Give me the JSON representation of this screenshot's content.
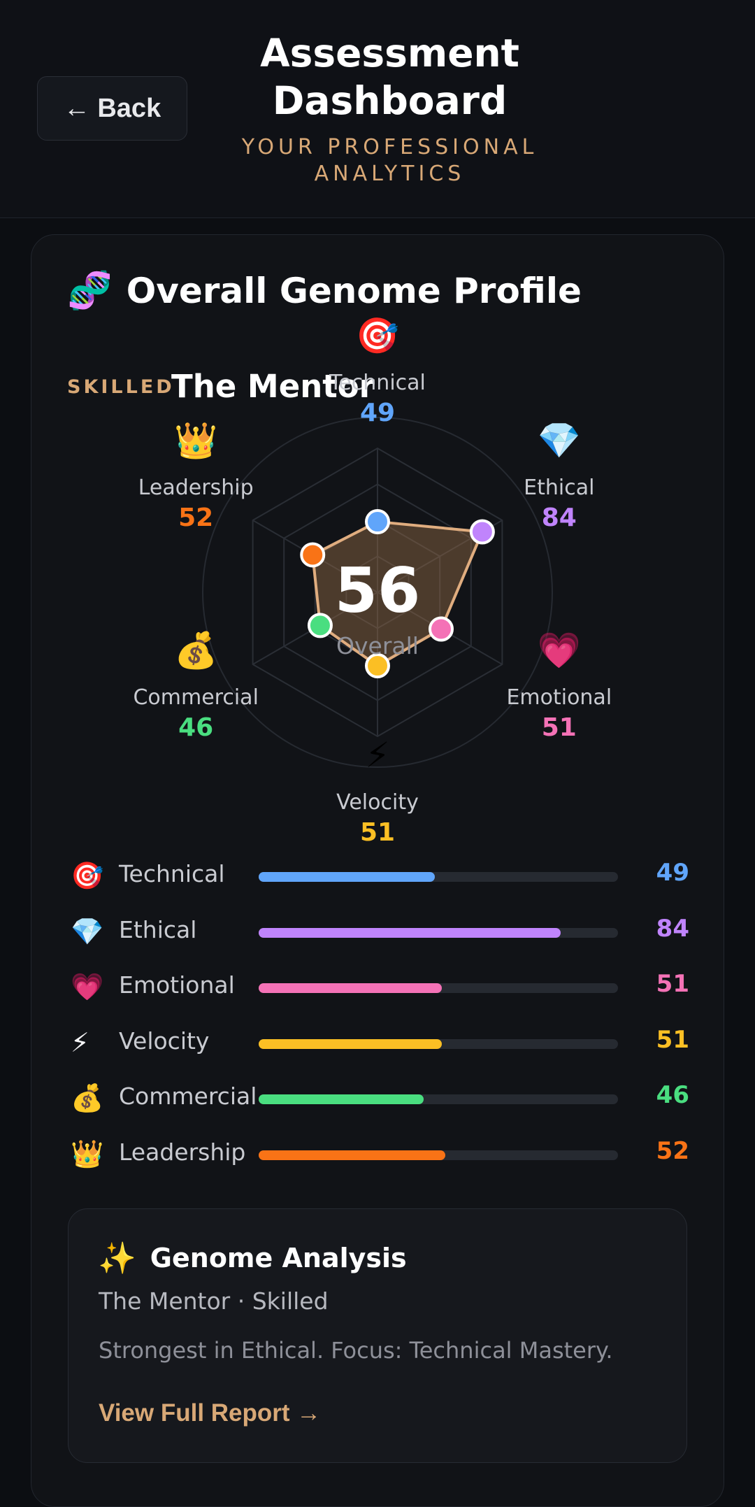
{
  "header": {
    "back_label": "← Back",
    "title": "Assessment Dashboard",
    "subtitle": "YOUR PROFESSIONAL ANALYTICS"
  },
  "profile": {
    "icon": "dna-icon",
    "icon_glyph": "🧬",
    "title": "Overall Genome Profile",
    "tier": "SKILLED",
    "archetype": "The Mentor",
    "overall_value": "56",
    "overall_label": "Overall"
  },
  "dimensions": [
    {
      "key": "technical",
      "label": "Technical",
      "value": 49,
      "display": "49",
      "icon": "target-icon",
      "glyph": "🎯",
      "color": "#60a5fa"
    },
    {
      "key": "ethical",
      "label": "Ethical",
      "value": 84,
      "display": "84",
      "icon": "gem-icon",
      "glyph": "💎",
      "color": "#c084fc"
    },
    {
      "key": "emotional",
      "label": "Emotional",
      "value": 51,
      "display": "51",
      "icon": "heart-icon",
      "glyph": "💗",
      "color": "#f472b6"
    },
    {
      "key": "velocity",
      "label": "Velocity",
      "value": 51,
      "display": "51",
      "icon": "lightning-icon",
      "glyph": "⚡",
      "color": "#fbbf24"
    },
    {
      "key": "commercial",
      "label": "Commercial",
      "value": 46,
      "display": "46",
      "icon": "money-bag-icon",
      "glyph": "💰",
      "color": "#4ade80"
    },
    {
      "key": "leadership",
      "label": "Leadership",
      "value": 52,
      "display": "52",
      "icon": "crown-icon",
      "glyph": "👑",
      "color": "#f97316"
    }
  ],
  "colors": {
    "accent": "#d8a876",
    "radar_fill": "#a0724a",
    "radar_stroke": "#e0ad7f"
  },
  "analysis": {
    "icon": "sparkles-icon",
    "glyph": "✨",
    "title": "Genome Analysis",
    "subtitle": "The Mentor · Skilled",
    "description": "Strongest in Ethical. Focus: Technical Mastery.",
    "link_label": "View Full Report →"
  }
}
